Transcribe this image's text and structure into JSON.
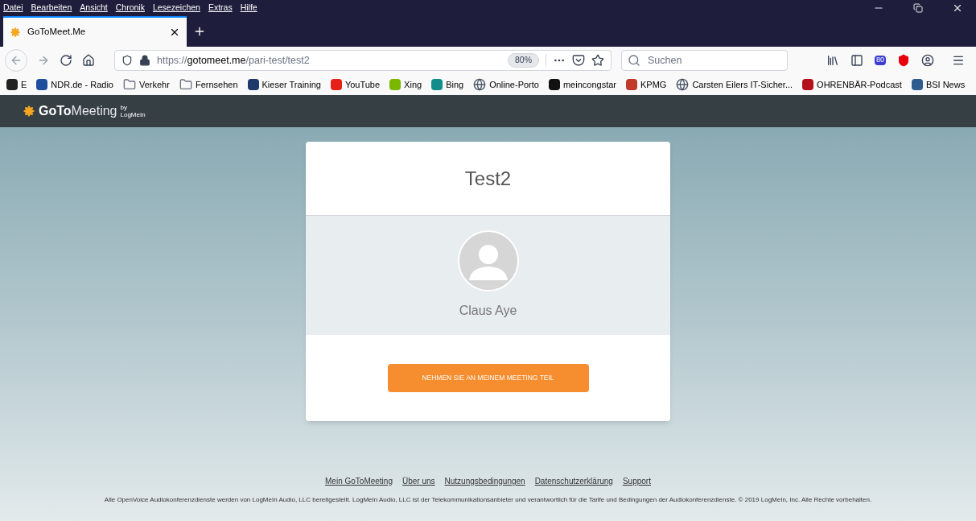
{
  "menu_bar": [
    "Datei",
    "Bearbeiten",
    "Ansicht",
    "Chronik",
    "Lesezeichen",
    "Extras",
    "Hilfe"
  ],
  "tabs": [
    {
      "label": "GoToMeet.Me",
      "selected": true
    }
  ],
  "address_bar": {
    "scheme": "https://",
    "host": "gotomeet.me",
    "path": "/pari-test/test2",
    "zoom": "80%"
  },
  "search": {
    "placeholder": "Suchen"
  },
  "toolbar_badge": "80",
  "bookmarks": [
    {
      "label": "E",
      "kind": "favicon",
      "color": "#222222"
    },
    {
      "label": "NDR.de - Radio",
      "kind": "favicon",
      "color": "#1f4f9c"
    },
    {
      "label": "Verkehr",
      "kind": "folder"
    },
    {
      "label": "Fernsehen",
      "kind": "folder"
    },
    {
      "label": "Kieser Training",
      "kind": "favicon",
      "color": "#1d3a6b"
    },
    {
      "label": "YouTube",
      "kind": "favicon",
      "color": "#e62117"
    },
    {
      "label": "Xing",
      "kind": "favicon",
      "color": "#7ab800"
    },
    {
      "label": "Bing",
      "kind": "favicon",
      "color": "#138c8c"
    },
    {
      "label": "Online-Porto",
      "kind": "globe"
    },
    {
      "label": "meincongstar",
      "kind": "favicon",
      "color": "#111111"
    },
    {
      "label": "KPMG",
      "kind": "favicon",
      "color": "#c0392b"
    },
    {
      "label": "Carsten Eilers IT-Sicher...",
      "kind": "globe"
    },
    {
      "label": "OHRENBÄR-Podcast",
      "kind": "favicon",
      "color": "#b3121b"
    },
    {
      "label": "BSI News",
      "kind": "favicon",
      "color": "#2f5c8f"
    }
  ],
  "site_header": {
    "brand_bold": "GoTo",
    "brand_light": "Meeting",
    "brand_by": "by",
    "brand_owner": "LogMeIn"
  },
  "card": {
    "title": "Test2",
    "organizer": "Claus Aye",
    "join_button": "NEHMEN SIE AN MEINEM MEETING TEIL"
  },
  "footer": {
    "links": [
      "Mein GoToMeeting",
      "Über uns",
      "Nutzungsbedingungen",
      "Datenschutzerklärung",
      "Support"
    ],
    "legal": "Alle OpenVoice Audiokonferenzdienste werden von LogMeIn Audio, LLC bereitgestellt. LogMeIn Audio, LLC ist der Telekommunikationsanbieter und verantwortlich für die Tarife und Bedingungen der Audiokonferenzdienste. © 2019 LogMeIn, Inc. Alle Rechte vorbehalten."
  }
}
